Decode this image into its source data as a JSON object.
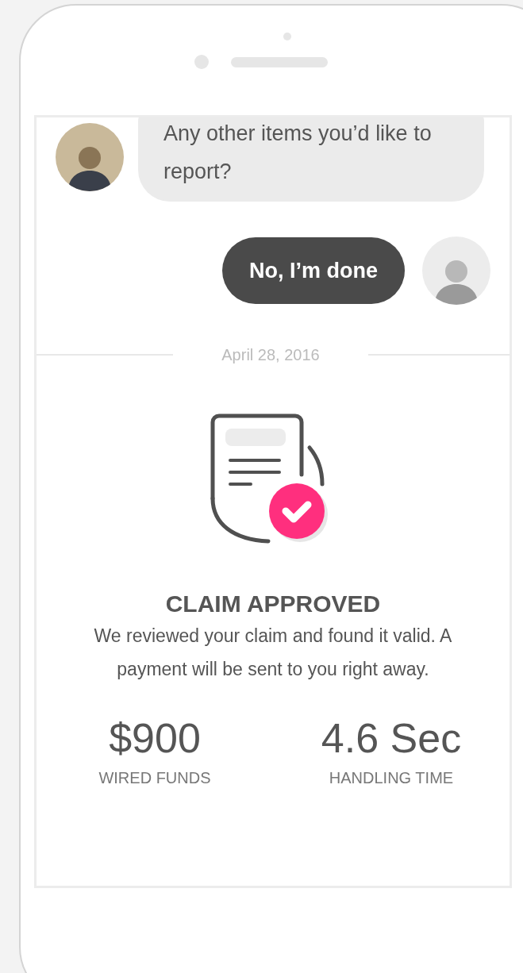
{
  "messages": [
    {
      "kind": "agent",
      "text": "Any other items you’d like to report?"
    },
    {
      "kind": "user",
      "text": "No, I’m done"
    }
  ],
  "date_divider": "April 28, 2016",
  "result": {
    "title": "CLAIM APPROVED",
    "text": "We reviewed your claim and found it valid. A payment will be sent to you right away."
  },
  "stats": [
    {
      "value": "$900",
      "label": "WIRED FUNDS"
    },
    {
      "value": "4.6 Sec",
      "label": "HANDLING TIME"
    }
  ]
}
